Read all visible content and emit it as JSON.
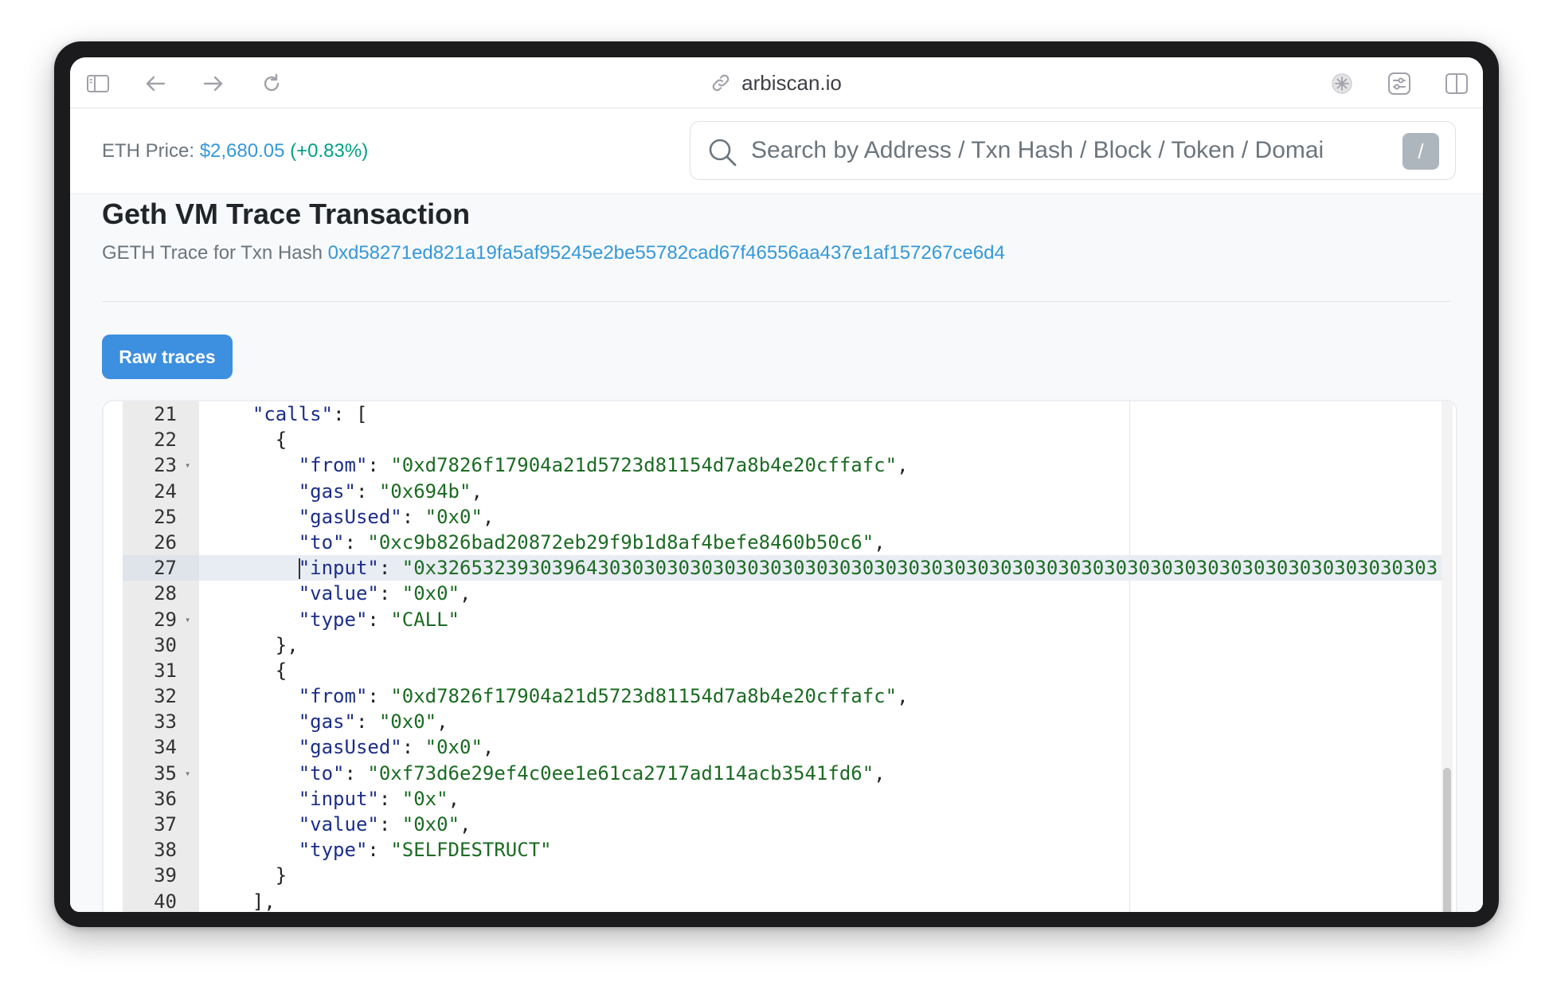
{
  "browser": {
    "url": "arbiscan.io",
    "icons": [
      "sidebar-icon",
      "back-arrow-icon",
      "forward-arrow-icon",
      "reload-icon",
      "link-icon",
      "extension-icon",
      "tune-icon",
      "split-view-icon"
    ]
  },
  "header": {
    "eth_price_label": "ETH Price: ",
    "eth_price_value": "$2,680.05",
    "eth_price_change": " (+0.83%)",
    "search_placeholder": "Search by Address / Txn Hash / Block / Token / Domai",
    "search_shortcut": "/"
  },
  "page": {
    "title": "Geth VM Trace Transaction",
    "subtitle_label": "GETH Trace for Txn Hash ",
    "txn_hash": "0xd58271ed821a19fa5af95245e2be55782cad67f46556aa437e1af157267ce6d4",
    "raw_traces_button": "Raw traces"
  },
  "editor": {
    "active_line": 27,
    "lines": [
      {
        "n": "21",
        "indent": "  ",
        "key": "\"calls\"",
        "sep": ": ",
        "val": "",
        "tail": "[",
        "fold": false
      },
      {
        "n": "22",
        "indent": "    ",
        "key": "",
        "sep": "",
        "val": "",
        "tail": "{",
        "fold": false
      },
      {
        "n": "23",
        "indent": "      ",
        "key": "\"from\"",
        "sep": ": ",
        "val": "\"0xd7826f17904a21d5723d81154d7a8b4e20cffafc\"",
        "tail": ",",
        "fold": true
      },
      {
        "n": "24",
        "indent": "      ",
        "key": "\"gas\"",
        "sep": ": ",
        "val": "\"0x694b\"",
        "tail": ",",
        "fold": false
      },
      {
        "n": "25",
        "indent": "      ",
        "key": "\"gasUsed\"",
        "sep": ": ",
        "val": "\"0x0\"",
        "tail": ",",
        "fold": false
      },
      {
        "n": "26",
        "indent": "      ",
        "key": "\"to\"",
        "sep": ": ",
        "val": "\"0xc9b826bad20872eb29f9b1d8af4befe8460b50c6\"",
        "tail": ",",
        "fold": false
      },
      {
        "n": "27",
        "indent": "      ",
        "key": "\"input\"",
        "sep": ": ",
        "val": "\"0x326532393039643030303030303030303030303030303030303030303030303030303030303030303030303",
        "tail": "",
        "fold": false
      },
      {
        "n": "28",
        "indent": "      ",
        "key": "\"value\"",
        "sep": ": ",
        "val": "\"0x0\"",
        "tail": ",",
        "fold": false
      },
      {
        "n": "29",
        "indent": "      ",
        "key": "\"type\"",
        "sep": ": ",
        "val": "\"CALL\"",
        "tail": "",
        "fold": true
      },
      {
        "n": "30",
        "indent": "    ",
        "key": "",
        "sep": "",
        "val": "",
        "tail": "},",
        "fold": false
      },
      {
        "n": "31",
        "indent": "    ",
        "key": "",
        "sep": "",
        "val": "",
        "tail": "{",
        "fold": false
      },
      {
        "n": "32",
        "indent": "      ",
        "key": "\"from\"",
        "sep": ": ",
        "val": "\"0xd7826f17904a21d5723d81154d7a8b4e20cffafc\"",
        "tail": ",",
        "fold": false
      },
      {
        "n": "33",
        "indent": "      ",
        "key": "\"gas\"",
        "sep": ": ",
        "val": "\"0x0\"",
        "tail": ",",
        "fold": false
      },
      {
        "n": "34",
        "indent": "      ",
        "key": "\"gasUsed\"",
        "sep": ": ",
        "val": "\"0x0\"",
        "tail": ",",
        "fold": false
      },
      {
        "n": "35",
        "indent": "      ",
        "key": "\"to\"",
        "sep": ": ",
        "val": "\"0xf73d6e29ef4c0ee1e61ca2717ad114acb3541fd6\"",
        "tail": ",",
        "fold": true
      },
      {
        "n": "36",
        "indent": "      ",
        "key": "\"input\"",
        "sep": ": ",
        "val": "\"0x\"",
        "tail": ",",
        "fold": false
      },
      {
        "n": "37",
        "indent": "      ",
        "key": "\"value\"",
        "sep": ": ",
        "val": "\"0x0\"",
        "tail": ",",
        "fold": false
      },
      {
        "n": "38",
        "indent": "      ",
        "key": "\"type\"",
        "sep": ": ",
        "val": "\"SELFDESTRUCT\"",
        "tail": "",
        "fold": false
      },
      {
        "n": "39",
        "indent": "    ",
        "key": "",
        "sep": "",
        "val": "",
        "tail": "}",
        "fold": false
      },
      {
        "n": "40",
        "indent": "  ",
        "key": "",
        "sep": "",
        "val": "",
        "tail": "],",
        "fold": false
      }
    ]
  },
  "colors": {
    "link": "#3498db",
    "positive_change": "#00a186",
    "button": "#3d8fe0",
    "json_key": "#1c2e8a",
    "json_string": "#1b6b22"
  }
}
